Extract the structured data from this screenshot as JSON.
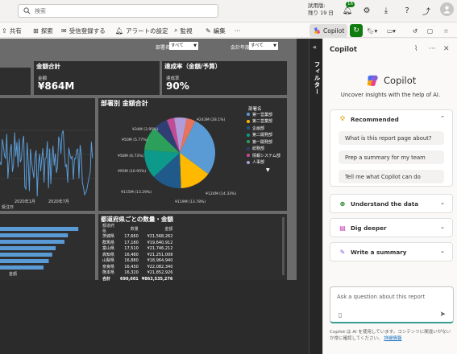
{
  "topbar": {
    "search_placeholder": "検索",
    "trial_line1": "試用版:",
    "trial_line2": "残り 19 日",
    "notification_count": "16"
  },
  "actionbar": {
    "share": "共有",
    "explore": "探索",
    "subscribe": "受信登録する",
    "alerts": "アラートの設定",
    "monitor": "監視",
    "edit": "編集",
    "more": "···",
    "copilot": "Copilot"
  },
  "report": {
    "slicer1_label": "部署名",
    "slicer1_value": "すべて",
    "slicer2_label": "会計年度",
    "slicer2_value": "すべて",
    "card_amount_title": "金額合計",
    "card_amount_label": "金額",
    "card_amount_value": "¥864M",
    "card_rate_title": "達成率（金額/予算）",
    "card_rate_label": "達成率",
    "card_rate_value": "90%",
    "line_xlabel_1": "2020年1月",
    "line_xlabel_2": "2020年7月",
    "line_axis_title": "受注日",
    "bar_footer": "金額",
    "pie_title": "部署別 金額合計",
    "pie_legend_title": "部署名",
    "table_title": "都道府県ごとの数量・金額",
    "table_headers": [
      "都道府県",
      "数量",
      "金額"
    ],
    "table_rows": [
      [
        "茨城県",
        "17,660",
        "¥21,568,262"
      ],
      [
        "群馬県",
        "17,180",
        "¥19,640,912"
      ],
      [
        "富山県",
        "17,510",
        "¥21,746,212"
      ],
      [
        "高知県",
        "16,480",
        "¥21,251,008"
      ],
      [
        "山梨県",
        "16,880",
        "¥18,964,940"
      ],
      [
        "奈良県",
        "16,430",
        "¥22,082,340"
      ],
      [
        "熊本県",
        "16,320",
        "¥21,852,926"
      ]
    ],
    "table_total": [
      "合計",
      "690,601",
      "¥863,535,276"
    ]
  },
  "chart_data": {
    "type": "pie",
    "title": "部署別 金額合計",
    "legend_title": "部署名",
    "slices": [
      {
        "label": "¥243M (28.1%)",
        "value": 28.1,
        "color": "#5b9bd5",
        "legend": "第一営業部"
      },
      {
        "label": "¥124M (14.33%)",
        "value": 14.33,
        "color": "#ffb900",
        "legend": "第二営業部"
      },
      {
        "label": "¥119M (13.78%)",
        "value": 13.78,
        "color": "#1f5a8b",
        "legend": "企画部"
      },
      {
        "label": "¥115M (13.29%)",
        "value": 13.29,
        "color": "#0e9a8a",
        "legend": "第二開発部"
      },
      {
        "label": "¥95M (10.95%)",
        "value": 10.95,
        "color": "#2ca05a",
        "legend": "第一開発部"
      },
      {
        "label": "¥58M (6.73%)",
        "value": 6.73,
        "color": "#2f3f73",
        "legend": "総務部"
      },
      {
        "label": "",
        "value": 3.5,
        "color": "#c24b96",
        "legend": "情報システム部"
      },
      {
        "label": "¥50M (5.77%)",
        "value": 5.77,
        "color": "#b19cd9",
        "legend": "人事部"
      },
      {
        "label": "¥34M (3.95%)",
        "value": 3.95,
        "color": "#e8735a",
        "legend": ""
      }
    ]
  },
  "bars": [
    0.9,
    0.78,
    0.74,
    0.64,
    0.6,
    0.56,
    0.5
  ],
  "copilot": {
    "title": "Copilot",
    "name": "Copilot",
    "subtitle": "Uncover insights with the help of AI.",
    "recommended": "Recommended",
    "prompts": [
      "What is this report page about?",
      "Prep a summary for my team",
      "Tell me what Copilot can do"
    ],
    "understand": "Understand the data",
    "dig": "Dig deeper",
    "summary": "Write a summary",
    "ask_placeholder": "Ask a question about this report",
    "disclaimer": "Copilot は AI を使用しています。コンテンツに間違いがないか常に確認してください。",
    "disclaimer_link": "詳細情報"
  },
  "filters": {
    "label": "フィルター"
  }
}
